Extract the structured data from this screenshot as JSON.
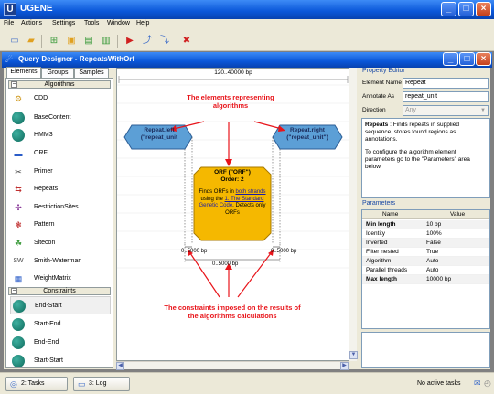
{
  "app": {
    "title": "UGENE",
    "icon_letter": "U",
    "window_buttons": [
      "minimize-button",
      "maximize-button",
      "close-button"
    ]
  },
  "menu": {
    "items": [
      "File",
      "Actions",
      "Settings",
      "Tools",
      "Window",
      "Help"
    ]
  },
  "toolbar": {
    "icons": [
      "new-project-icon",
      "open-icon",
      "add-icon",
      "folder-icon",
      "document-icon",
      "link-icon",
      "run-icon",
      "split-icon",
      "merge-icon",
      "remove-icon"
    ]
  },
  "query_window": {
    "title": "Query Designer - RepeatsWithOrf"
  },
  "left_panel": {
    "tabs": [
      "Elements",
      "Groups",
      "Samples"
    ],
    "algorithms_header": "Algorithms",
    "algorithms": [
      {
        "label": "CDD",
        "icon": "cdd-icon"
      },
      {
        "label": "BaseContent",
        "icon": "circle-icon"
      },
      {
        "label": "HMM3",
        "icon": "circle-icon"
      },
      {
        "label": "ORF",
        "icon": "orf-icon"
      },
      {
        "label": "Primer",
        "icon": "primer-icon"
      },
      {
        "label": "Repeats",
        "icon": "repeats-icon"
      },
      {
        "label": "RestrictionSites",
        "icon": "restriction-icon"
      },
      {
        "label": "Pattern",
        "icon": "pattern-icon"
      },
      {
        "label": "Sitecon",
        "icon": "sitecon-icon"
      },
      {
        "label": "Smith-Waterman",
        "icon": "sw-icon"
      },
      {
        "label": "WeightMatrix",
        "icon": "weightmatrix-icon"
      }
    ],
    "constraints_header": "Constraints",
    "constraints": [
      "End-Start",
      "Start-End",
      "End-End",
      "Start-Start"
    ]
  },
  "canvas": {
    "range_label": "120..40000 bp",
    "repeat_left": {
      "line1": "Repeat.left",
      "line2": "(\"repeat_unit"
    },
    "repeat_right": {
      "line1": "Repeat.right",
      "line2": "(\"repeat_unit\")"
    },
    "orf": {
      "line1": "ORF (\"ORF\")",
      "line2": "Order: 2",
      "desc_pre": "Finds ORFs in ",
      "desc_link1": "both strands",
      "desc_mid": " using the ",
      "desc_link2": "1. The Standard Genetic Code",
      "desc_post": ". Detects only ORFs"
    },
    "constraint_left": "0..5000 bp",
    "constraint_right": "0..5000 bp",
    "constraint_bottom": "0..5000 bp",
    "annotation_top": "The elements representing algorithms",
    "annotation_bottom": "The constraints imposed on the results of the algorithms calculations"
  },
  "property_editor": {
    "title": "Property Editor",
    "element_name_label": "Element Name",
    "element_name_value": "Repeat",
    "annotate_as_label": "Annotate As",
    "annotate_as_value": "repeat_unit",
    "direction_label": "Direction",
    "direction_value": "Any",
    "desc_bold": "Repeats",
    "desc_text": " : Finds repeats in supplied sequence, stores found regions as annotations.",
    "desc_text2": "To configure the algorithm element parameters go to the \"Parameters\" area below."
  },
  "parameters": {
    "title": "Parameters",
    "col_name": "Name",
    "col_value": "Value",
    "rows": [
      {
        "name": "Min length",
        "value": "10 bp",
        "bold": true
      },
      {
        "name": "Identity",
        "value": "100%",
        "bold": false
      },
      {
        "name": "Inverted",
        "value": "False",
        "bold": false
      },
      {
        "name": "Filter nested",
        "value": "True",
        "bold": false
      },
      {
        "name": "Algorithm",
        "value": "Auto",
        "bold": false
      },
      {
        "name": "Parallel threads",
        "value": "Auto",
        "bold": false
      },
      {
        "name": "Max length",
        "value": "10000 bp",
        "bold": true
      }
    ]
  },
  "statusbar": {
    "tasks_tab": "2: Tasks",
    "log_tab": "3: Log",
    "status_text": "No active tasks"
  },
  "colors": {
    "accent_red": "#e8141a",
    "hex_blue": "#5c9fd6",
    "orf_orange": "#f5b800",
    "xp_blue": "#0a56d8"
  }
}
